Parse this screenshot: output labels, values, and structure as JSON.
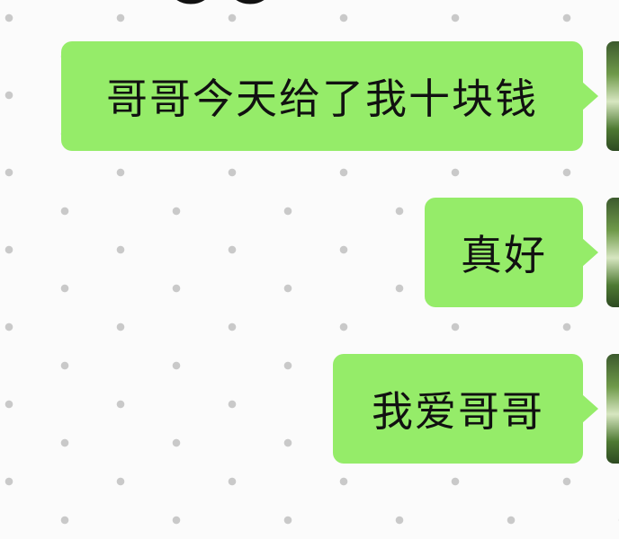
{
  "chat": {
    "messages": [
      {
        "text": "哥哥今天给了我十块钱",
        "side": "right"
      },
      {
        "text": "真好",
        "side": "right"
      },
      {
        "text": "我爱哥哥",
        "side": "right"
      }
    ]
  },
  "colors": {
    "bubble": "#95ec69",
    "background": "#fbfbfb",
    "pattern": "#c9c9c9",
    "text": "#111111"
  },
  "icons": {
    "top_partial": "glasses-icon",
    "avatar": "avatar"
  }
}
